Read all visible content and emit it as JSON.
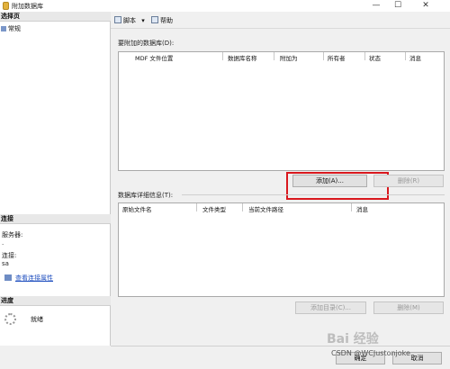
{
  "window": {
    "title": "附加数据库",
    "min": "—",
    "max": "☐",
    "close": "✕"
  },
  "left": {
    "pages_header": "选择页",
    "pages": [
      {
        "label": "常规"
      }
    ],
    "connection_header": "连接",
    "server_label": "服务器:",
    "server_value": ".",
    "connection_label": "连接:",
    "connection_value": "sa",
    "view_conn_props": "查看连接属性",
    "progress_header": "进度",
    "status": "就绪"
  },
  "toolbar": {
    "script_label": "脚本",
    "script_caret": "▾",
    "help_label": "帮助"
  },
  "attach": {
    "label": "要附加的数据库(D):",
    "columns": [
      "MDF 文件位置",
      "数据库名称",
      "附加为",
      "所有者",
      "状态",
      "消息"
    ],
    "add_button": "添加(A)...",
    "remove_button": "删除(R)"
  },
  "details": {
    "label": "数据库详细信息(T):",
    "columns": [
      "原始文件名",
      "文件类型",
      "当前文件路径",
      "消息"
    ],
    "add_catalog_button": "添加目录(C)...",
    "remove_button": "删除(M)"
  },
  "footer": {
    "ok_button": "确定",
    "cancel_button": "取消",
    "watermark": "Bai 经验",
    "csdn": "CSDN @WCJustonjoke"
  },
  "colors": {
    "highlight": "#d9181e",
    "link": "#1f4fbf"
  }
}
